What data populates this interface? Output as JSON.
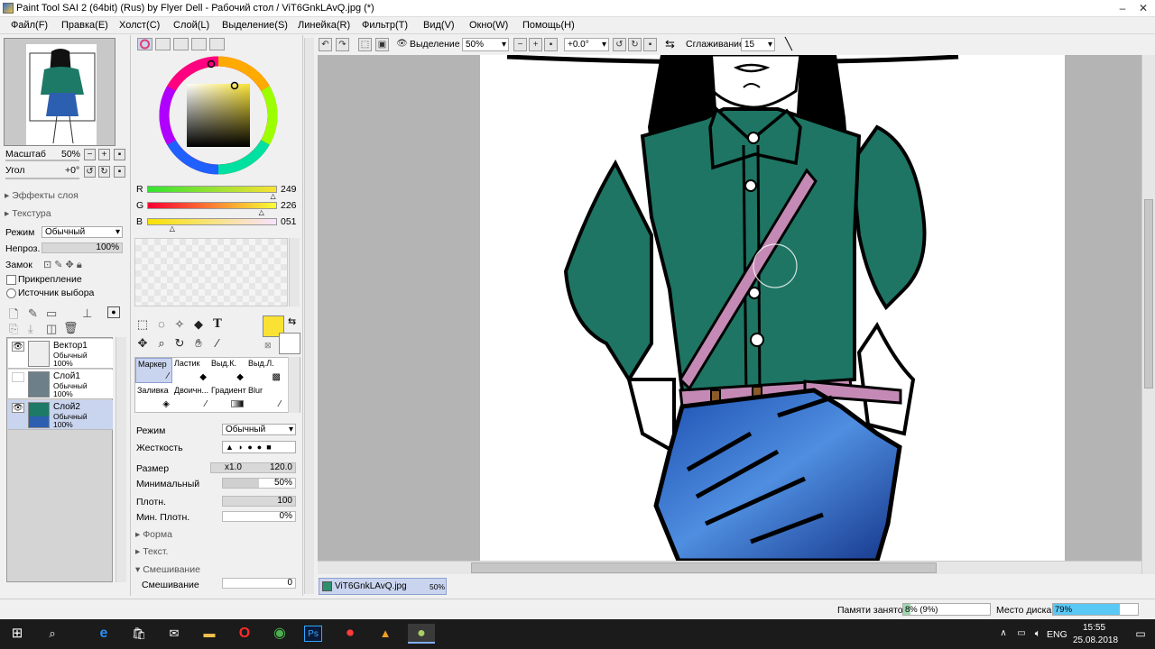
{
  "window": {
    "title": "Paint Tool SAI 2 (64bit) (Rus) by Flyer Dell - Рабочий стол / ViT6GnkLAvQ.jpg (*)"
  },
  "menu": [
    "Файл(F)",
    "Правка(E)",
    "Холст(C)",
    "Слой(L)",
    "Выделение(S)",
    "Линейка(R)",
    "Фильтр(T)",
    "Вид(V)",
    "Окно(W)",
    "Помощь(H)"
  ],
  "nav": {
    "zoom_label": "Масштаб",
    "zoom_value": "50%",
    "angle_label": "Угол",
    "angle_value": "+0°"
  },
  "layer_props": {
    "effects": "Эффекты слоя",
    "texture": "Текстура",
    "mode_label": "Режим",
    "mode_value": "Обычный",
    "opacity_label": "Непроз.",
    "opacity_value": "100%",
    "lock_label": "Замок",
    "clip_label": "Прикрепление",
    "selsrc_label": "Источник выбора",
    "opacity_fraction": 1.0
  },
  "layers": [
    {
      "name": "Вектор1",
      "mode": "Обычный",
      "opacity": "100%"
    },
    {
      "name": "Слой1",
      "mode": "Обычный",
      "opacity": "100%"
    },
    {
      "name": "Слой2",
      "mode": "Обычный",
      "opacity": "100%"
    }
  ],
  "color": {
    "r_label": "R",
    "g_label": "G",
    "b_label": "B",
    "r": "249",
    "g": "226",
    "b": "051",
    "r_fraction": 0.976,
    "g_fraction": 0.886,
    "b_fraction": 0.2,
    "primary": "#f9e233",
    "secondary": "#ffffff"
  },
  "brushes": [
    {
      "name": "Маркер"
    },
    {
      "name": "Ластик"
    },
    {
      "name": "Выд.К."
    },
    {
      "name": "Выд.Л."
    },
    {
      "name": "Заливка"
    },
    {
      "name": "Двоичн..."
    },
    {
      "name": "Градиент"
    },
    {
      "name": "Blur"
    }
  ],
  "brush_props": {
    "mode_label": "Режим",
    "mode_value": "Обычный",
    "hardness_label": "Жесткость",
    "size_label": "Размер",
    "size_mult": "x1.0",
    "size_value": "120.0",
    "min_label": "Минимальный",
    "min_value": "50%",
    "density_label": "Плотн.",
    "density_value": "100",
    "min_density_label": "Мин. Плотн.",
    "min_density_value": "0%",
    "shape_label": "Форма",
    "text_label": "Текст.",
    "blend_section": "Смешивание",
    "blend_label": "Смешивание",
    "blend_value": "0"
  },
  "toolbar": {
    "selection_label": "Выделение",
    "zoom_value": "50%",
    "angle_value": "+0.0°",
    "smoothing_label": "Сглаживание",
    "smoothing_value": "15"
  },
  "doc_tab": {
    "name": "ViT6GnkLAvQ.jpg",
    "zoom": "50%"
  },
  "status": {
    "memory_label": "Памяти занято",
    "memory_value": "8% (9%)",
    "memory_fraction": 0.08,
    "disk_label": "Место диска",
    "disk_value": "79%",
    "disk_fraction": 0.79
  },
  "taskbar": {
    "lang": "ENG",
    "time": "15:55",
    "date": "25.08.2018"
  },
  "icons": [
    "windows-icon",
    "search-icon",
    "edge-icon",
    "store-icon",
    "mail-icon",
    "folder-icon",
    "opera-icon",
    "chrome-icon",
    "photoshop-icon",
    "record-icon",
    "sai-icon"
  ]
}
